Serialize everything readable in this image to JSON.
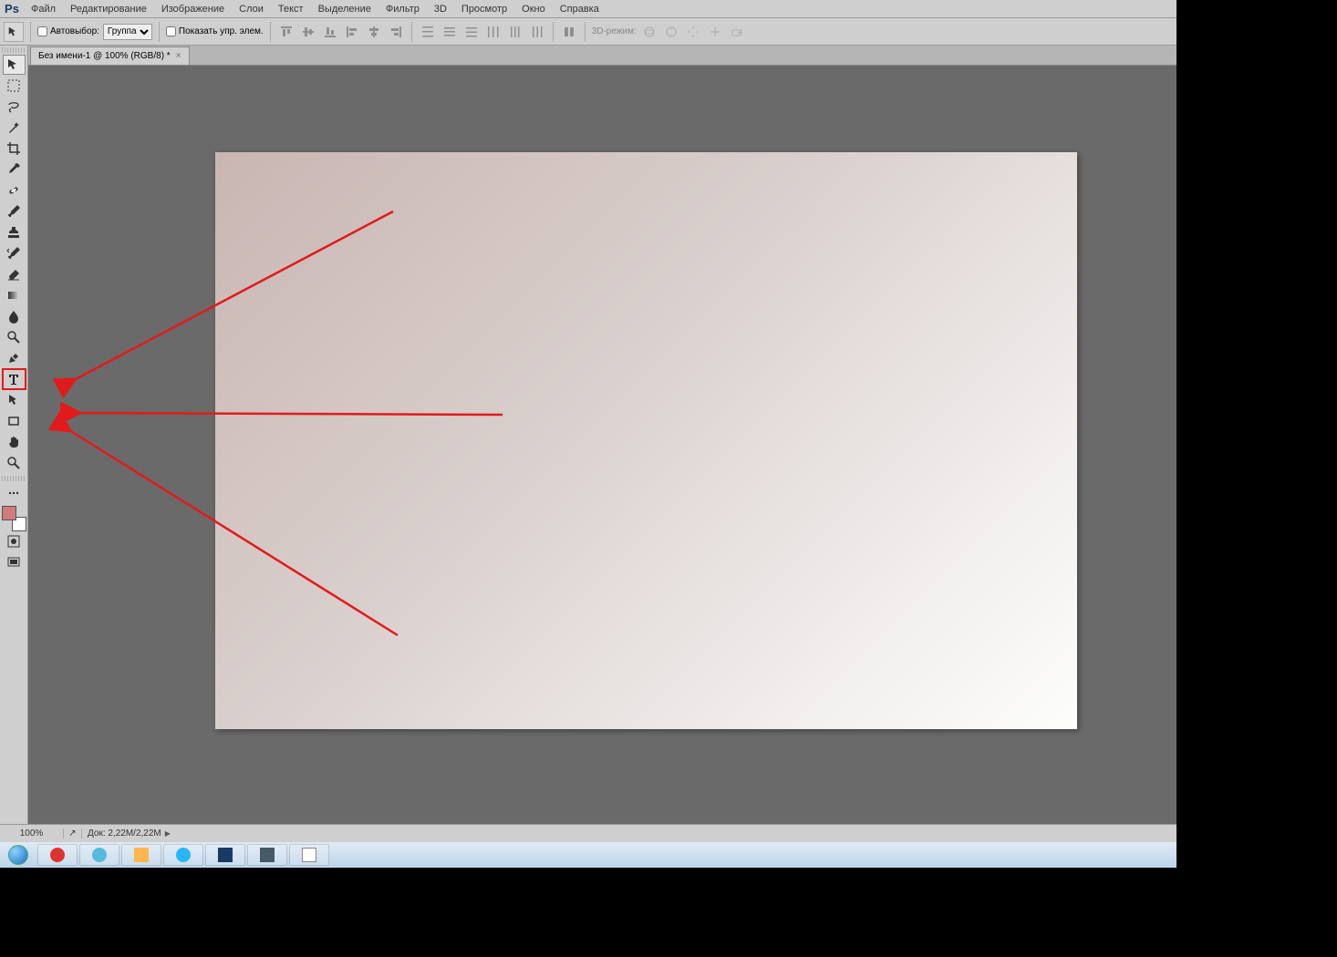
{
  "menubar": {
    "logo": "Ps",
    "items": [
      "Файл",
      "Редактирование",
      "Изображение",
      "Слои",
      "Текст",
      "Выделение",
      "Фильтр",
      "3D",
      "Просмотр",
      "Окно",
      "Справка"
    ]
  },
  "optbar": {
    "autoselect_label": "Автовыбор:",
    "group_select": "Группа",
    "show_controls_label": "Показать упр. элем.",
    "mode3d_label": "3D-режим:"
  },
  "tabs": {
    "doc1": {
      "title": "Без имени-1 @ 100% (RGB/8) *",
      "close": "×"
    }
  },
  "status": {
    "zoom": "100%",
    "doc_label": "Док: 2,22M/2,22M"
  },
  "colors": {
    "highlight": "#e11b1b",
    "canvas_bg": "#6a6a6a",
    "fg_swatch": "#d27b7b",
    "bg_swatch": "#ffffff"
  },
  "tools": [
    {
      "name": "move-tool"
    },
    {
      "name": "marquee-tool"
    },
    {
      "name": "lasso-tool"
    },
    {
      "name": "magic-wand-tool"
    },
    {
      "name": "crop-tool"
    },
    {
      "name": "eyedropper-tool"
    },
    {
      "name": "healing-brush-tool"
    },
    {
      "name": "brush-tool"
    },
    {
      "name": "clone-stamp-tool"
    },
    {
      "name": "history-brush-tool"
    },
    {
      "name": "eraser-tool"
    },
    {
      "name": "gradient-tool"
    },
    {
      "name": "blur-tool"
    },
    {
      "name": "dodge-tool"
    },
    {
      "name": "pen-tool"
    },
    {
      "name": "type-tool",
      "highlight": true
    },
    {
      "name": "path-selection-tool"
    },
    {
      "name": "rectangle-tool"
    },
    {
      "name": "hand-tool"
    },
    {
      "name": "zoom-tool"
    }
  ]
}
